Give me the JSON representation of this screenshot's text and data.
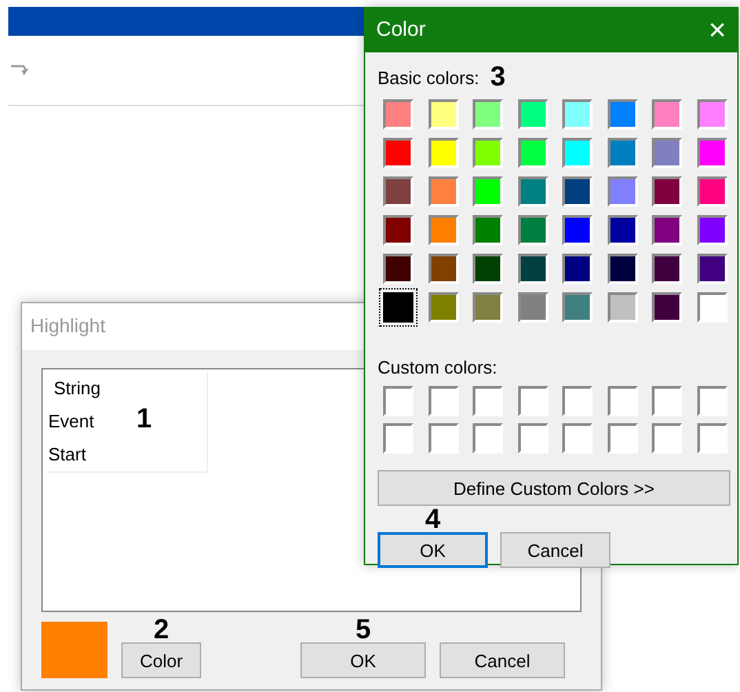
{
  "highlight_dialog": {
    "title": "Highlight",
    "items": [
      {
        "label": "String"
      },
      {
        "label": "Event"
      },
      {
        "label": "Start"
      }
    ],
    "list_annotation": "1",
    "preview": {
      "color": "#ff8000"
    },
    "color_annotation": "2",
    "ok_annotation": "5",
    "buttons": [
      {
        "kind": "color",
        "label": "Color"
      },
      {
        "kind": "ok",
        "label": "OK"
      },
      {
        "kind": "cancel",
        "label": "Cancel"
      }
    ]
  },
  "color_dialog": {
    "title": "Color",
    "close": "×",
    "basic_label": "Basic colors:",
    "basic_annotation": "3",
    "basic_colors": [
      {
        "color": "#ff8080",
        "selected": false
      },
      {
        "color": "#ffff80",
        "selected": false
      },
      {
        "color": "#80ff80",
        "selected": false
      },
      {
        "color": "#00ff80",
        "selected": false
      },
      {
        "color": "#80ffff",
        "selected": false
      },
      {
        "color": "#0080ff",
        "selected": false
      },
      {
        "color": "#ff80c0",
        "selected": false
      },
      {
        "color": "#ff80ff",
        "selected": false
      },
      {
        "color": "#ff0000",
        "selected": false
      },
      {
        "color": "#ffff00",
        "selected": false
      },
      {
        "color": "#80ff00",
        "selected": false
      },
      {
        "color": "#00ff40",
        "selected": false
      },
      {
        "color": "#00ffff",
        "selected": false
      },
      {
        "color": "#0080c0",
        "selected": false
      },
      {
        "color": "#8080c0",
        "selected": false
      },
      {
        "color": "#ff00ff",
        "selected": false
      },
      {
        "color": "#804040",
        "selected": false
      },
      {
        "color": "#ff8040",
        "selected": false
      },
      {
        "color": "#00ff00",
        "selected": false
      },
      {
        "color": "#008080",
        "selected": false
      },
      {
        "color": "#004080",
        "selected": false
      },
      {
        "color": "#8080ff",
        "selected": false
      },
      {
        "color": "#800040",
        "selected": false
      },
      {
        "color": "#ff0080",
        "selected": false
      },
      {
        "color": "#800000",
        "selected": false
      },
      {
        "color": "#ff8000",
        "selected": false
      },
      {
        "color": "#008000",
        "selected": false
      },
      {
        "color": "#008040",
        "selected": false
      },
      {
        "color": "#0000ff",
        "selected": false
      },
      {
        "color": "#0000a0",
        "selected": false
      },
      {
        "color": "#800080",
        "selected": false
      },
      {
        "color": "#8000ff",
        "selected": false
      },
      {
        "color": "#400000",
        "selected": false
      },
      {
        "color": "#804000",
        "selected": false
      },
      {
        "color": "#004000",
        "selected": false
      },
      {
        "color": "#004040",
        "selected": false
      },
      {
        "color": "#000080",
        "selected": false
      },
      {
        "color": "#000040",
        "selected": false
      },
      {
        "color": "#400040",
        "selected": false
      },
      {
        "color": "#400080",
        "selected": false
      },
      {
        "color": "#000000",
        "selected": true
      },
      {
        "color": "#808000",
        "selected": false
      },
      {
        "color": "#808040",
        "selected": false
      },
      {
        "color": "#808080",
        "selected": false
      },
      {
        "color": "#408080",
        "selected": false
      },
      {
        "color": "#c0c0c0",
        "selected": false
      },
      {
        "color": "#400040",
        "selected": false
      },
      {
        "color": "#ffffff",
        "selected": false
      }
    ],
    "custom_label": "Custom colors:",
    "custom_colors": [
      {
        "color": "#ffffff"
      },
      {
        "color": "#ffffff"
      },
      {
        "color": "#ffffff"
      },
      {
        "color": "#ffffff"
      },
      {
        "color": "#ffffff"
      },
      {
        "color": "#ffffff"
      },
      {
        "color": "#ffffff"
      },
      {
        "color": "#ffffff"
      },
      {
        "color": "#ffffff"
      },
      {
        "color": "#ffffff"
      },
      {
        "color": "#ffffff"
      },
      {
        "color": "#ffffff"
      },
      {
        "color": "#ffffff"
      },
      {
        "color": "#ffffff"
      },
      {
        "color": "#ffffff"
      },
      {
        "color": "#ffffff"
      }
    ],
    "define_button": "Define Custom Colors >>",
    "ok_annotation": "4",
    "buttons": [
      {
        "label": "OK",
        "focused": true
      },
      {
        "label": "Cancel",
        "focused": false
      }
    ]
  }
}
